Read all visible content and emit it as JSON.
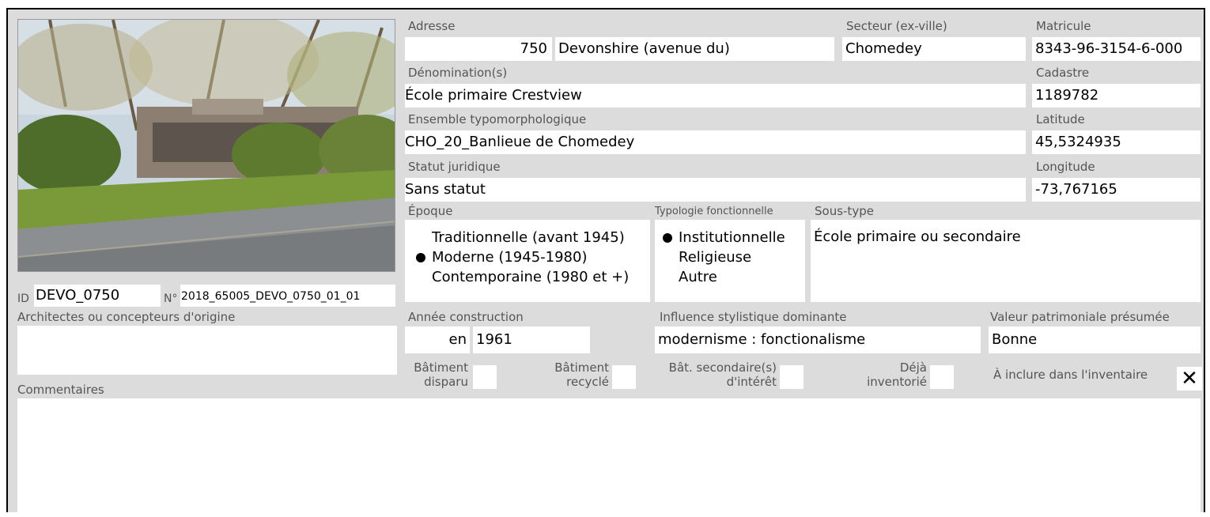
{
  "photo": {
    "alt": "photo-batiment"
  },
  "id": {
    "label": "ID",
    "value": "DEVO_0750"
  },
  "numero": {
    "label": "N°",
    "value": "2018_65005_DEVO_0750_01_01"
  },
  "adresse": {
    "label": "Adresse",
    "numero": "750",
    "rue": "Devonshire (avenue du)"
  },
  "secteur": {
    "label": "Secteur (ex-ville)",
    "value": "Chomedey"
  },
  "matricule": {
    "label": "Matricule",
    "value": "8343-96-3154-6-000"
  },
  "denomination": {
    "label": "Dénomination(s)",
    "value": "École primaire Crestview"
  },
  "cadastre": {
    "label": "Cadastre",
    "value": "1189782"
  },
  "ensemble": {
    "label": "Ensemble typomorphologique",
    "value": "CHO_20_Banlieue de Chomedey"
  },
  "latitude": {
    "label": "Latitude",
    "value": "45,5324935"
  },
  "statut": {
    "label": "Statut juridique",
    "value": "Sans statut"
  },
  "longitude": {
    "label": "Longitude",
    "value": "-73,767165"
  },
  "epoque": {
    "label": "Époque",
    "options": [
      {
        "text": "Traditionnelle (avant 1945)",
        "selected": false
      },
      {
        "text": "Moderne (1945-1980)",
        "selected": true
      },
      {
        "text": "Contemporaine (1980 et +)",
        "selected": false
      }
    ]
  },
  "typologie": {
    "label": "Typologie fonctionnelle",
    "options": [
      {
        "text": "Institutionnelle",
        "selected": true
      },
      {
        "text": "Religieuse",
        "selected": false
      },
      {
        "text": "Autre",
        "selected": false
      }
    ]
  },
  "soustype": {
    "label": "Sous-type",
    "value": "École primaire ou secondaire"
  },
  "architectes": {
    "label": "Architectes ou concepteurs d'origine",
    "value": ""
  },
  "annee": {
    "label": "Année construction",
    "prefix": "en",
    "value": "1961"
  },
  "influence": {
    "label": "Influence stylistique dominante",
    "value": "modernisme : fonctionalisme"
  },
  "valeur": {
    "label": "Valeur patrimoniale présumée",
    "value": "Bonne"
  },
  "checkboxes": {
    "disparu": {
      "line1": "Bâtiment",
      "line2": "disparu",
      "checked": false
    },
    "recycle": {
      "line1": "Bâtiment",
      "line2": "recyclé",
      "checked": false
    },
    "secondaire": {
      "line1": "Bât. secondaire(s)",
      "line2": "d'intérêt",
      "checked": false
    },
    "inventorie": {
      "line1": "Déjà",
      "line2": "inventorié",
      "checked": false
    },
    "inventaire": {
      "label": "À inclure dans l'inventaire",
      "checked": true,
      "mark": "✕"
    }
  },
  "commentaires": {
    "label": "Commentaires",
    "value": ""
  }
}
